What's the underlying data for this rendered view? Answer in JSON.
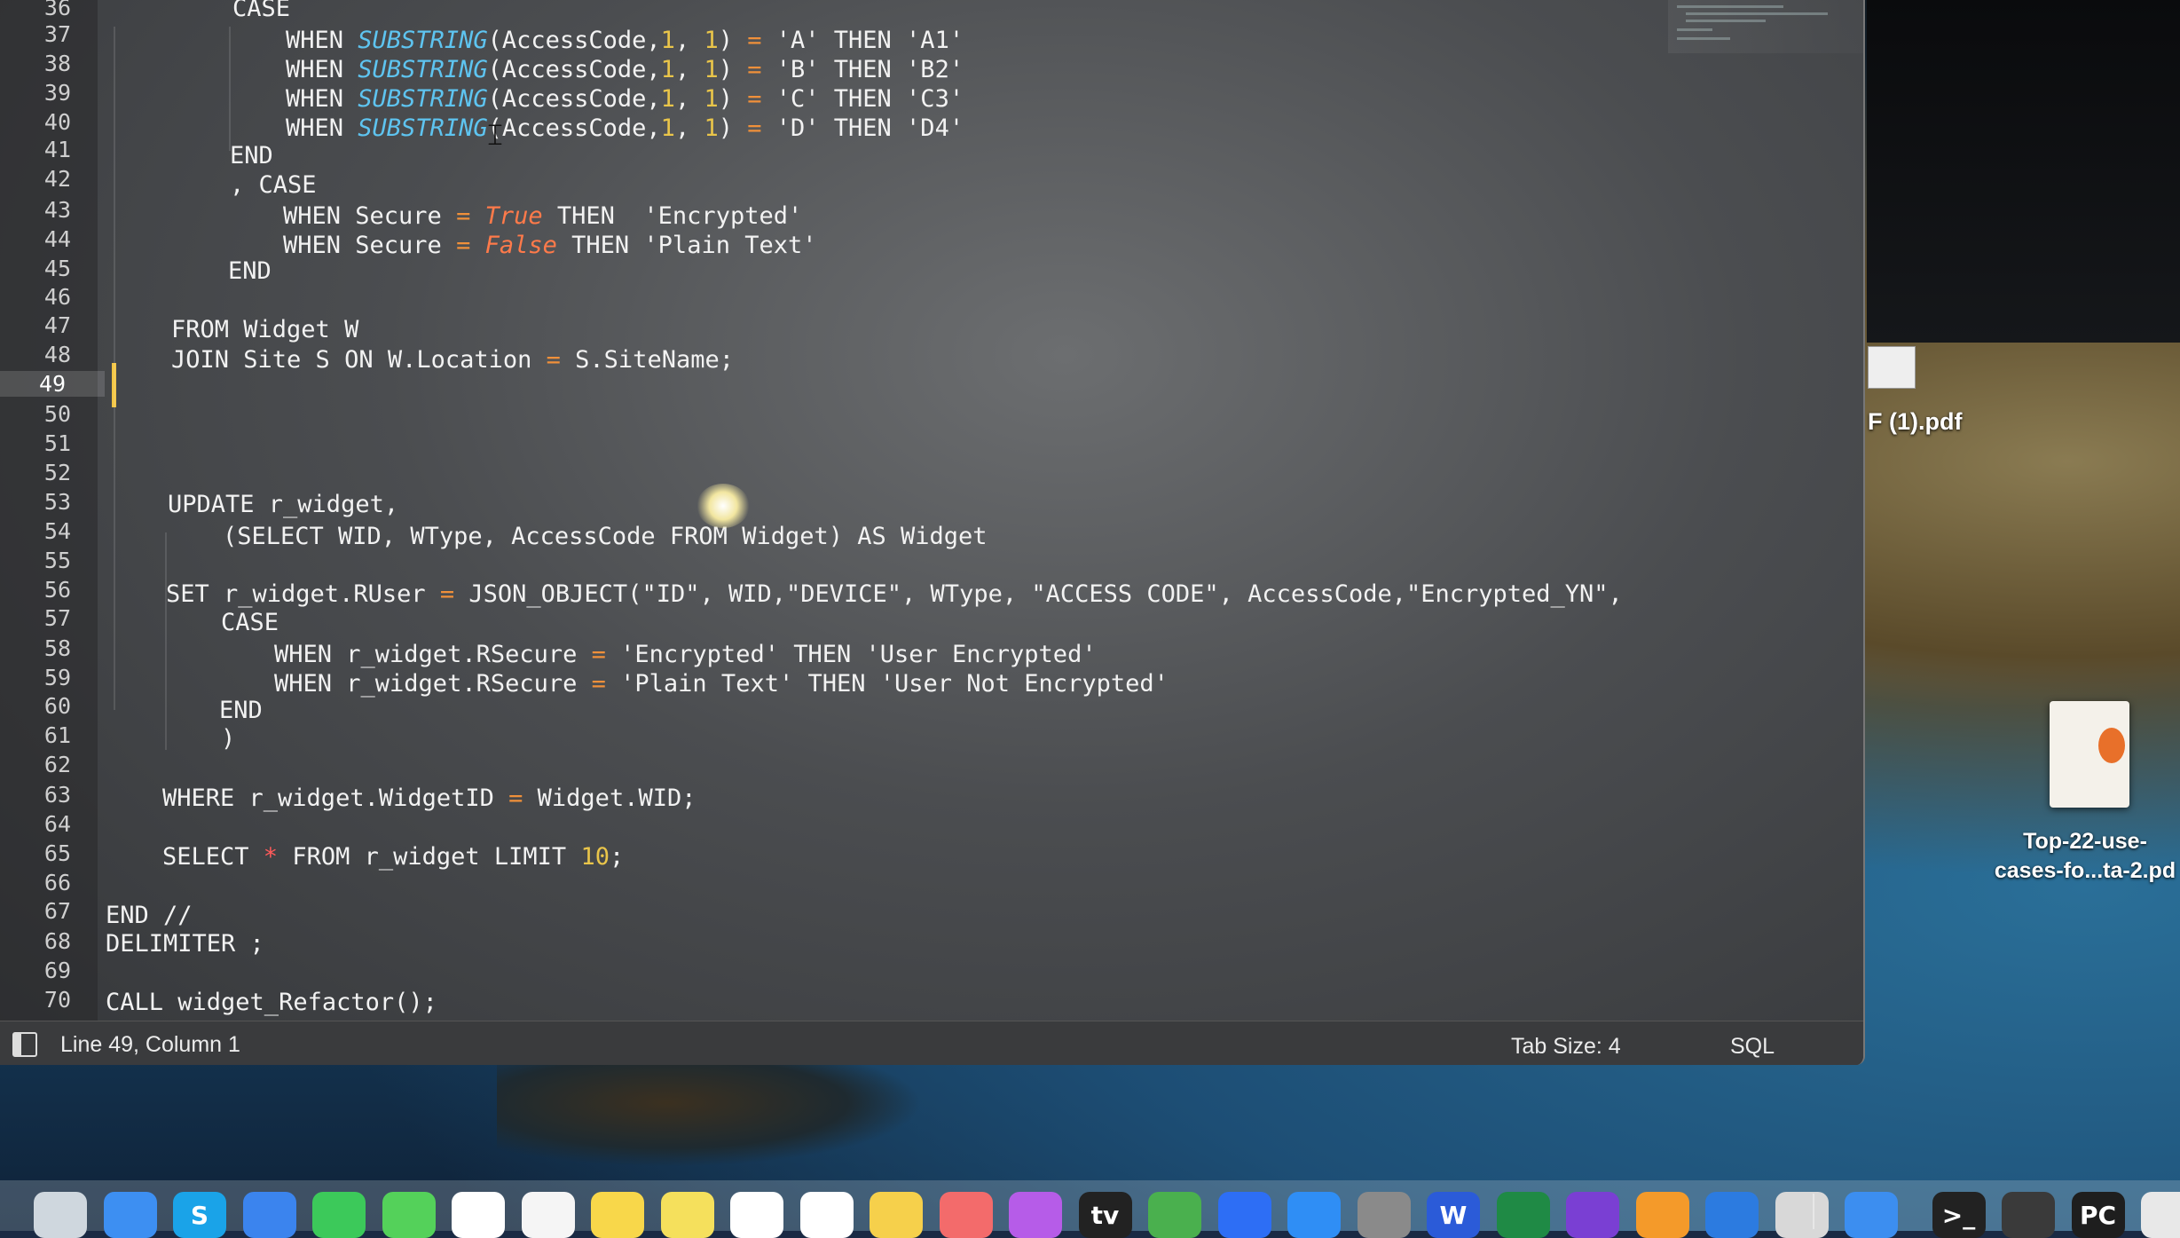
{
  "editor": {
    "line_numbers": [
      "36",
      "37",
      "38",
      "39",
      "40",
      "41",
      "42",
      "43",
      "44",
      "45",
      "46",
      "47",
      "48",
      "49",
      "50",
      "51",
      "52",
      "53",
      "54",
      "55",
      "56",
      "57",
      "58",
      "59",
      "60",
      "61",
      "62",
      "63",
      "64",
      "65",
      "66",
      "67",
      "68",
      "69",
      "70"
    ],
    "active_line": "49",
    "code": {
      "l36": "CASE",
      "l37_a": "WHEN ",
      "l37_fn": "SUBSTRING",
      "l37_b": "(AccessCode,",
      "l37_n1": "1",
      "l37_c": ", ",
      "l37_n2": "1",
      "l37_d": ") ",
      "l37_eq": "=",
      "l37_e": " 'A' THEN 'A1'",
      "l38_a": "WHEN ",
      "l38_fn": "SUBSTRING",
      "l38_b": "(AccessCode,",
      "l38_n1": "1",
      "l38_c": ", ",
      "l38_n2": "1",
      "l38_d": ") ",
      "l38_eq": "=",
      "l38_e": " 'B' THEN 'B2'",
      "l39_a": "WHEN ",
      "l39_fn": "SUBSTRING",
      "l39_b": "(AccessCode,",
      "l39_n1": "1",
      "l39_c": ", ",
      "l39_n2": "1",
      "l39_d": ") ",
      "l39_eq": "=",
      "l39_e": " 'C' THEN 'C3'",
      "l40_a": "WHEN ",
      "l40_fn": "SUBSTRING",
      "l40_b": "(AccessCode,",
      "l40_n1": "1",
      "l40_c": ", ",
      "l40_n2": "1",
      "l40_d": ") ",
      "l40_eq": "=",
      "l40_e": " 'D' THEN 'D4'",
      "l41": "END",
      "l42": ", CASE",
      "l43_a": "WHEN Secure ",
      "l43_eq": "=",
      "l43_bool": " True",
      "l43_b": " THEN  'Encrypted'",
      "l44_a": "WHEN Secure ",
      "l44_eq": "=",
      "l44_bool": " False",
      "l44_b": " THEN 'Plain Text'",
      "l45": "END",
      "l47": "FROM Widget W",
      "l48_a": "JOIN Site S ON W.Location ",
      "l48_eq": "=",
      "l48_b": " S.SiteName;",
      "l53": "UPDATE r_widget,",
      "l54": "(SELECT WID, WType, AccessCode FROM Widget) AS Widget",
      "l56_a": "SET r_widget.RUser ",
      "l56_eq": "=",
      "l56_b": " JSON_OBJECT(\"ID\", WID,\"DEVICE\", WType, \"ACCESS CODE\", AccessCode,\"Encrypted_YN\",",
      "l57": "CASE",
      "l58_a": "WHEN r_widget.RSecure ",
      "l58_eq": "=",
      "l58_b": " 'Encrypted' THEN 'User Encrypted'",
      "l59_a": "WHEN r_widget.RSecure ",
      "l59_eq": "=",
      "l59_b": " 'Plain Text' THEN 'User Not Encrypted'",
      "l60": "END",
      "l61": ")",
      "l63_a": "WHERE r_widget.WidgetID ",
      "l63_eq": "=",
      "l63_b": " Widget.WID;",
      "l65_a": "SELECT ",
      "l65_star": "*",
      "l65_b": " FROM r_widget LIMIT ",
      "l65_num": "10",
      "l65_c": ";",
      "l67": "END //",
      "l68": "DELIMITER ;",
      "l70": "CALL widget_Refactor();"
    }
  },
  "statusbar": {
    "position": "Line 49, Column 1",
    "tab_size": "Tab Size: 4",
    "language": "SQL"
  },
  "desktop": {
    "pdf_partial_label": "F (1).pdf",
    "pdf_file_label_line1": "Top-22-use-",
    "pdf_file_label_line2": "cases-fo...ta-2.pd"
  },
  "dock": {
    "icons": [
      "finder-icon",
      "safari-icon",
      "skype-icon",
      "mail-icon",
      "facetime-icon",
      "messages-icon",
      "maps-icon",
      "photos-icon",
      "notes-icon",
      "stickies-icon",
      "calendar-icon",
      "reminders-icon",
      "notes2-icon",
      "music-icon",
      "podcasts-icon",
      "tv-icon",
      "numbers-icon",
      "keynote-icon",
      "appstore-icon",
      "system-preferences-icon",
      "word-icon",
      "excel-icon",
      "github-icon",
      "sublime-icon",
      "vscode-icon",
      "preview-icon",
      "chrome-icon",
      "terminal-icon",
      "instruments-icon",
      "pycharm-icon",
      "documents-icon",
      "trash-icon"
    ],
    "tv_label": "tv",
    "pycharm_label": "PC",
    "word_label": "W",
    "skype_label": "S",
    "terminal_label": ">_"
  },
  "colors": {
    "keyword": "#ffffff",
    "function": "#5ec4f0",
    "number": "#e9c54a",
    "operator": "#f0903a",
    "boolean": "#ff7a4a",
    "cursor_line_marker": "#f4c542"
  }
}
